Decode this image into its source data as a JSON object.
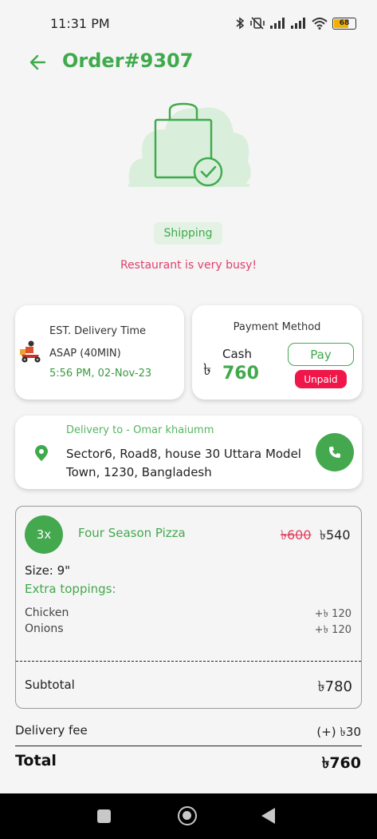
{
  "status_bar": {
    "time": "11:31 PM",
    "battery": "68"
  },
  "header": {
    "title": "Order#9307"
  },
  "order_status": "Shipping",
  "notice": "Restaurant is very busy!",
  "delivery_time": {
    "label": "EST. Delivery Time",
    "estimate": "ASAP (40MIN)",
    "datetime": "5:56 PM, 02-Nov-23"
  },
  "payment": {
    "title": "Payment Method",
    "currency_symbol": "৳",
    "method": "Cash",
    "amount": "760",
    "pay_button": "Pay",
    "status": "Unpaid"
  },
  "address": {
    "label": "Delivery to - Omar khaiumm",
    "text": "Sector6, Road8, house 30 Uttara Model Town, 1230, Bangladesh"
  },
  "item": {
    "quantity": "3x",
    "name": "Four Season Pizza",
    "old_price": "৳600",
    "price": "৳540",
    "size": "Size: 9\"",
    "extras_label": "Extra toppings:",
    "toppings": [
      {
        "name": "Chicken",
        "price": "+৳ 120"
      },
      {
        "name": "Onions",
        "price": "+৳ 120"
      }
    ],
    "subtotal_label": "Subtotal",
    "subtotal_value": "৳780"
  },
  "summary": {
    "delivery_fee_label": "Delivery fee",
    "delivery_fee_value": "(+) ৳30",
    "total_label": "Total",
    "total_value": "৳760"
  },
  "colors": {
    "brand_green": "#3faa4c",
    "alert_pink": "#e0406e",
    "unpaid_red": "#f0164a"
  }
}
